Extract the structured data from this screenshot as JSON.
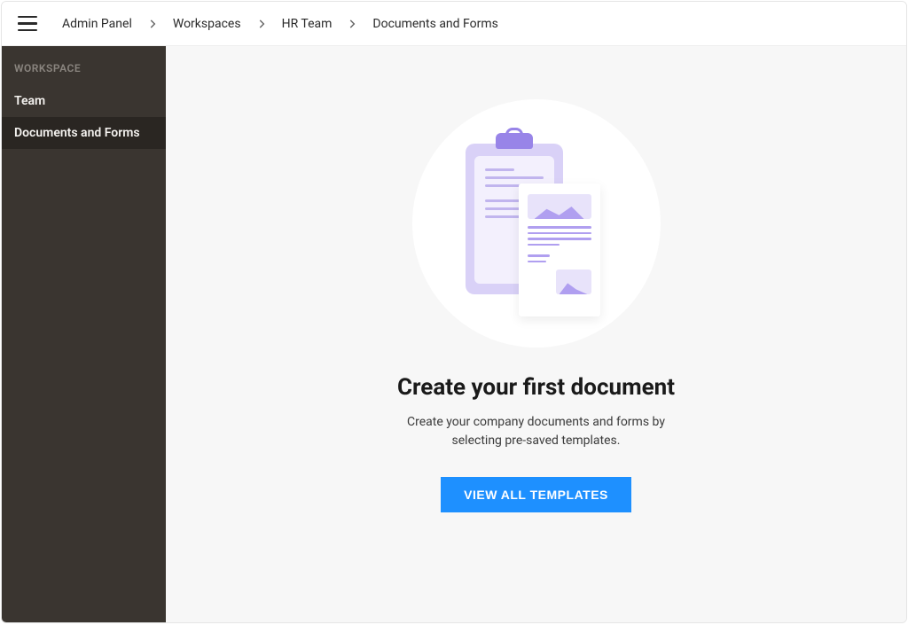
{
  "breadcrumb": {
    "items": [
      {
        "label": "Admin Panel"
      },
      {
        "label": "Workspaces"
      },
      {
        "label": "HR Team"
      },
      {
        "label": "Documents and Forms"
      }
    ]
  },
  "sidebar": {
    "section_label": "WORKSPACE",
    "items": [
      {
        "label": "Team",
        "active": false
      },
      {
        "label": "Documents and Forms",
        "active": true
      }
    ]
  },
  "empty_state": {
    "heading": "Create your first document",
    "subtext": "Create your company documents and forms by selecting pre-saved templates.",
    "cta_label": "VIEW ALL TEMPLATES"
  },
  "colors": {
    "accent": "#1e90ff",
    "sidebar_bg": "#3a3530",
    "illustration_primary": "#b09ff0"
  }
}
